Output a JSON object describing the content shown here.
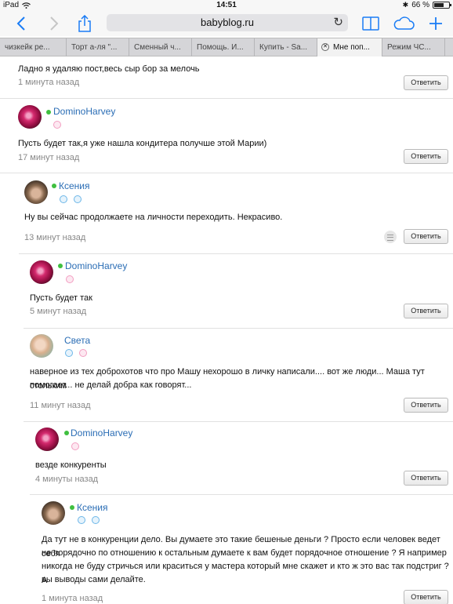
{
  "status_bar": {
    "device": "iPad",
    "time": "14:51",
    "battery": "66 %",
    "battery_level": 0.66
  },
  "toolbar": {
    "url": "babyblog.ru"
  },
  "tabs": [
    {
      "label": "чизкейк ре..."
    },
    {
      "label": "Торт а-ля \"..."
    },
    {
      "label": "Сменный ч..."
    },
    {
      "label": "Помощь. И..."
    },
    {
      "label": "Купить - Sa..."
    },
    {
      "label": "Мне поп..."
    },
    {
      "label": "Режим ЧС..."
    }
  ],
  "reply_label": "Ответить",
  "top": {
    "text": "Ладно я удаляю пост,весь сыр бор за мелочь",
    "time": "1 минута назад"
  },
  "comments": [
    {
      "author": "DominoHarvey",
      "text": "Пусть будет так,я уже нашла кондитера получше этой Марии)",
      "time": "17 минут назад"
    },
    {
      "author": "Ксения",
      "text": "Ну вы сейчас продолжаете на личности переходить. Некрасиво.",
      "time": "13 минут назад"
    },
    {
      "author": "DominoHarvey",
      "text": "Пусть будет так",
      "time": "5 минут назад"
    },
    {
      "author": "Света",
      "text_lines": [
        "наверное из тех доброхотов что про Машу нехорошо в личку написали.... вот же люди... Маша тут стольким",
        "помогает... не делай добра как говорят..."
      ],
      "time": "11 минут назад"
    },
    {
      "author": "DominoHarvey",
      "text": "везде конкуренты",
      "time": "4 минуты назад"
    },
    {
      "author": "Ксения",
      "text_lines": [
        "Да тут не в конкуренции дело. Вы думаете это такие бешеные деньги ? Просто если человек ведет себя",
        "не порядочно по отношению к остальным думаете к вам будет порядочное отношение ? Я например",
        "никогда не буду стричься или краситься у мастера который  мне скажет и кто ж это вас так подстриг ? А",
        "вы выводы сами делайте."
      ],
      "time": "1 минута назад"
    }
  ]
}
